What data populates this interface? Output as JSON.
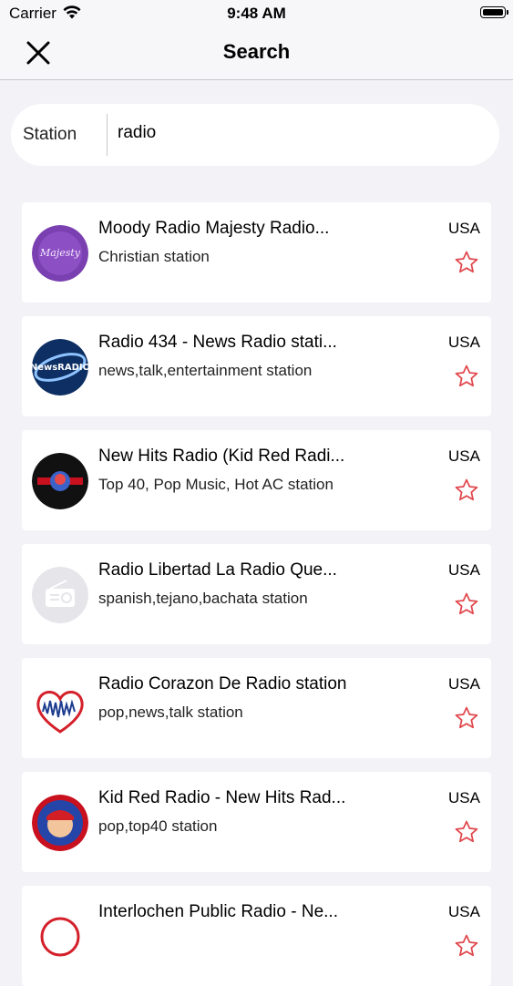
{
  "status_bar": {
    "carrier": "Carrier",
    "time": "9:48 AM"
  },
  "nav": {
    "title": "Search",
    "close_icon": "close-icon"
  },
  "search": {
    "scope_label": "Station",
    "query": "radio"
  },
  "accent_color": "#e0474c",
  "stations": [
    {
      "name": "Moody Radio Majesty Radio...",
      "genre": "Christian  station",
      "country": "USA",
      "logo": "majesty"
    },
    {
      "name": "Radio 434 - News Radio stati...",
      "genre": "news,talk,entertainment station",
      "country": "USA",
      "logo": "newsradio"
    },
    {
      "name": "New Hits Radio (Kid Red Radi...",
      "genre": "Top 40, Pop Music, Hot AC station",
      "country": "USA",
      "logo": "newhits"
    },
    {
      "name": "Radio Libertad La Radio Que...",
      "genre": "spanish,tejano,bachata station",
      "country": "USA",
      "logo": "placeholder-radio"
    },
    {
      "name": "Radio Corazon De Radio station",
      "genre": "pop,news,talk station",
      "country": "USA",
      "logo": "corazon"
    },
    {
      "name": "Kid Red Radio - New Hits Rad...",
      "genre": "pop,top40 station",
      "country": "USA",
      "logo": "kidred"
    },
    {
      "name": "Interlochen Public Radio - Ne...",
      "genre": "",
      "country": "USA",
      "logo": "interlochen"
    }
  ]
}
